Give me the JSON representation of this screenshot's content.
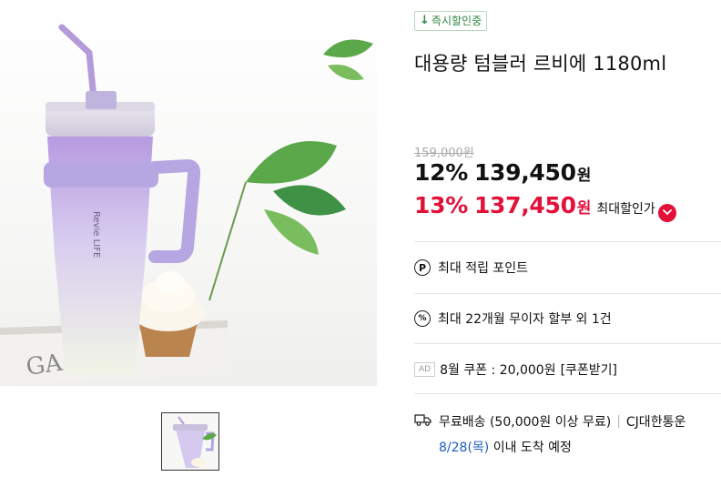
{
  "badge": {
    "icon": "down-arrow-icon",
    "text": "즉시할인중"
  },
  "product": {
    "title": "대용량 텀블러 르비에 1180ml",
    "brand_print": "Revie LIFE"
  },
  "pricing": {
    "original": "159,000원",
    "offer": {
      "percent": "12%",
      "amount": "139,450",
      "unit": "원"
    },
    "max_offer": {
      "percent": "13%",
      "amount": "137,450",
      "unit": "원",
      "label": "최대할인가",
      "icon": "chevron-down-icon"
    }
  },
  "benefits": [
    {
      "icon": "point-icon",
      "glyph": "P",
      "text": "최대 적립 포인트"
    },
    {
      "icon": "percent-icon",
      "glyph": "%",
      "text": "최대 22개월 무이자 할부 외 1건"
    }
  ],
  "coupon": {
    "ad_tag": "AD",
    "text": "8월 쿠폰 : 20,000원",
    "link": "[쿠폰받기]"
  },
  "shipping": {
    "icon": "truck-icon",
    "method": "무료배송 (50,000원 이상 무료)",
    "carrier": "CJ대한통운",
    "eta_date": "8/28(목)",
    "eta_text": "이내 도착 예정"
  },
  "colors": {
    "discount_red": "#e3103a",
    "badge_green": "#2d8a43",
    "eta_blue": "#1c5ec2"
  }
}
